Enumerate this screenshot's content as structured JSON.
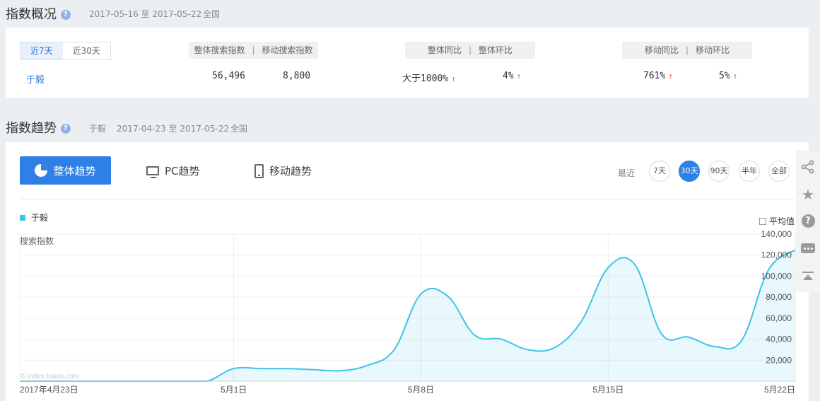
{
  "overview": {
    "title": "指数概况",
    "date_range": "2017-05-16 至 2017-05-22",
    "region": "全国",
    "range_tabs": [
      "近7天",
      "近30天"
    ],
    "active_tab": "近7天",
    "entity": "于毅",
    "headers": {
      "overall_search": "整体搜索指数",
      "mobile_search": "移动搜索指数",
      "overall_yoy": "整体同比",
      "overall_mom": "整体环比",
      "mobile_yoy": "移动同比",
      "mobile_mom": "移动环比",
      "sep": "|"
    },
    "values": {
      "overall_search": "56,496",
      "mobile_search": "8,800",
      "overall_yoy": "大于1000%",
      "overall_mom": "4%",
      "mobile_yoy": "761%",
      "mobile_mom": "5%"
    },
    "trend_arrow": "↑",
    "arrow_color": "#ef6b3a"
  },
  "trend": {
    "title": "指数趋势",
    "entity": "于毅",
    "date_range": "2017-04-23 至 2017-05-22",
    "region": "全国",
    "tabs": {
      "overall": "整体趋势",
      "pc": "PC趋势",
      "mobile": "移动趋势"
    },
    "recent_label": "最近",
    "periods": [
      "7天",
      "30天",
      "90天",
      "半年",
      "全部"
    ],
    "active_period": "30天",
    "avg_label": "平均值",
    "watermark": "© index.baidu.com",
    "accent": "#2e7fe6",
    "line_color": "#3ec3ea"
  },
  "chart_data": {
    "type": "area",
    "ylabel": "搜索指数",
    "ylim": [
      0,
      140000
    ],
    "yticks": [
      "20,000",
      "40,000",
      "60,000",
      "80,000",
      "100,000",
      "120,000",
      "140,000"
    ],
    "x_tick_labels": [
      "2017年4月23日",
      "5月1日",
      "5月8日",
      "5月15日",
      "5月22日"
    ],
    "x_tick_indices": [
      0,
      8,
      15,
      22,
      29
    ],
    "grid": true,
    "legend_position": "top-left",
    "series": [
      {
        "name": "于毅",
        "values": [
          0,
          0,
          0,
          0,
          0,
          0,
          0,
          0,
          12000,
          12000,
          12000,
          11000,
          10000,
          15000,
          30000,
          83000,
          81000,
          44000,
          40000,
          30000,
          32000,
          57000,
          108000,
          111000,
          45000,
          42000,
          33000,
          39000,
          106000,
          125000
        ]
      }
    ]
  },
  "side_tools": [
    "share-icon",
    "star-icon",
    "help-icon",
    "comment-icon",
    "back-to-top-icon"
  ]
}
